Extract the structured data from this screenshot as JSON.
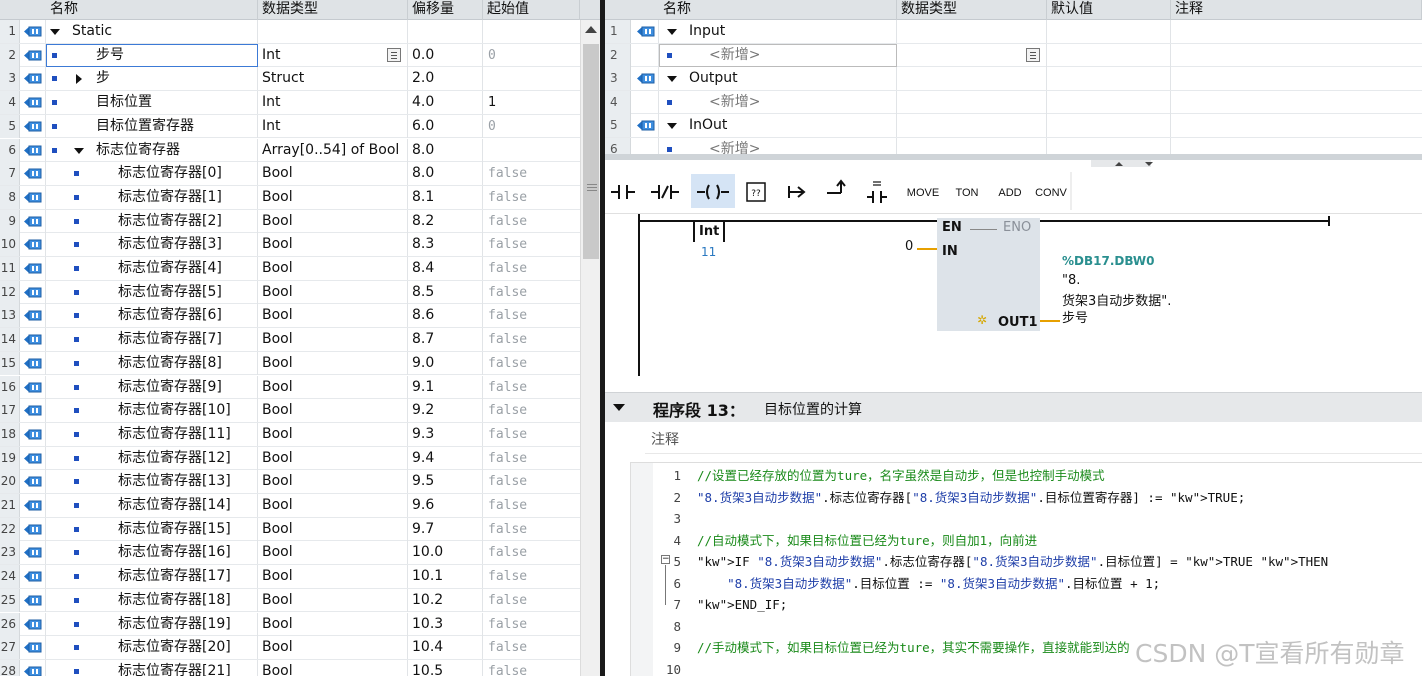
{
  "left_table": {
    "headers": {
      "name": "名称",
      "datatype": "数据类型",
      "offset": "偏移量",
      "start": "起始值"
    },
    "rows": [
      {
        "n": "1",
        "name": "Static",
        "type": "",
        "offset": "",
        "start": "",
        "level": 0,
        "marker": "down",
        "bullet": false
      },
      {
        "n": "2",
        "name": "步号",
        "type": "Int",
        "offset": "0.0",
        "start": "0",
        "level": 1,
        "marker": "",
        "bullet": true,
        "editing": true
      },
      {
        "n": "3",
        "name": "步",
        "type": "Struct",
        "offset": "2.0",
        "start": "",
        "level": 1,
        "marker": "right",
        "bullet": true
      },
      {
        "n": "4",
        "name": "目标位置",
        "type": "Int",
        "offset": "4.0",
        "start": "1",
        "level": 1,
        "marker": "",
        "bullet": true,
        "startdark": true
      },
      {
        "n": "5",
        "name": "目标位置寄存器",
        "type": "Int",
        "offset": "6.0",
        "start": "0",
        "level": 1,
        "marker": "",
        "bullet": true
      },
      {
        "n": "6",
        "name": "标志位寄存器",
        "type": "Array[0..54] of Bool",
        "offset": "8.0",
        "start": "",
        "level": 1,
        "marker": "down",
        "bullet": true
      },
      {
        "n": "7",
        "name": "标志位寄存器[0]",
        "type": "Bool",
        "offset": "8.0",
        "start": "false",
        "level": 2,
        "bullet": true
      },
      {
        "n": "8",
        "name": "标志位寄存器[1]",
        "type": "Bool",
        "offset": "8.1",
        "start": "false",
        "level": 2,
        "bullet": true
      },
      {
        "n": "9",
        "name": "标志位寄存器[2]",
        "type": "Bool",
        "offset": "8.2",
        "start": "false",
        "level": 2,
        "bullet": true
      },
      {
        "n": "10",
        "name": "标志位寄存器[3]",
        "type": "Bool",
        "offset": "8.3",
        "start": "false",
        "level": 2,
        "bullet": true
      },
      {
        "n": "11",
        "name": "标志位寄存器[4]",
        "type": "Bool",
        "offset": "8.4",
        "start": "false",
        "level": 2,
        "bullet": true
      },
      {
        "n": "12",
        "name": "标志位寄存器[5]",
        "type": "Bool",
        "offset": "8.5",
        "start": "false",
        "level": 2,
        "bullet": true
      },
      {
        "n": "13",
        "name": "标志位寄存器[6]",
        "type": "Bool",
        "offset": "8.6",
        "start": "false",
        "level": 2,
        "bullet": true
      },
      {
        "n": "14",
        "name": "标志位寄存器[7]",
        "type": "Bool",
        "offset": "8.7",
        "start": "false",
        "level": 2,
        "bullet": true
      },
      {
        "n": "15",
        "name": "标志位寄存器[8]",
        "type": "Bool",
        "offset": "9.0",
        "start": "false",
        "level": 2,
        "bullet": true
      },
      {
        "n": "16",
        "name": "标志位寄存器[9]",
        "type": "Bool",
        "offset": "9.1",
        "start": "false",
        "level": 2,
        "bullet": true
      },
      {
        "n": "17",
        "name": "标志位寄存器[10]",
        "type": "Bool",
        "offset": "9.2",
        "start": "false",
        "level": 2,
        "bullet": true
      },
      {
        "n": "18",
        "name": "标志位寄存器[11]",
        "type": "Bool",
        "offset": "9.3",
        "start": "false",
        "level": 2,
        "bullet": true
      },
      {
        "n": "19",
        "name": "标志位寄存器[12]",
        "type": "Bool",
        "offset": "9.4",
        "start": "false",
        "level": 2,
        "bullet": true
      },
      {
        "n": "20",
        "name": "标志位寄存器[13]",
        "type": "Bool",
        "offset": "9.5",
        "start": "false",
        "level": 2,
        "bullet": true
      },
      {
        "n": "21",
        "name": "标志位寄存器[14]",
        "type": "Bool",
        "offset": "9.6",
        "start": "false",
        "level": 2,
        "bullet": true
      },
      {
        "n": "22",
        "name": "标志位寄存器[15]",
        "type": "Bool",
        "offset": "9.7",
        "start": "false",
        "level": 2,
        "bullet": true
      },
      {
        "n": "23",
        "name": "标志位寄存器[16]",
        "type": "Bool",
        "offset": "10.0",
        "start": "false",
        "level": 2,
        "bullet": true
      },
      {
        "n": "24",
        "name": "标志位寄存器[17]",
        "type": "Bool",
        "offset": "10.1",
        "start": "false",
        "level": 2,
        "bullet": true
      },
      {
        "n": "25",
        "name": "标志位寄存器[18]",
        "type": "Bool",
        "offset": "10.2",
        "start": "false",
        "level": 2,
        "bullet": true
      },
      {
        "n": "26",
        "name": "标志位寄存器[19]",
        "type": "Bool",
        "offset": "10.3",
        "start": "false",
        "level": 2,
        "bullet": true
      },
      {
        "n": "27",
        "name": "标志位寄存器[20]",
        "type": "Bool",
        "offset": "10.4",
        "start": "false",
        "level": 2,
        "bullet": true
      },
      {
        "n": "28",
        "name": "标志位寄存器[21]",
        "type": "Bool",
        "offset": "10.5",
        "start": "false",
        "level": 2,
        "bullet": true
      }
    ]
  },
  "interface": {
    "headers": {
      "name": "名称",
      "datatype": "数据类型",
      "default": "默认值",
      "comment": "注释"
    },
    "rows": [
      {
        "n": "1",
        "name": "Input",
        "section": true
      },
      {
        "n": "2",
        "name": "<新增>",
        "section": false,
        "editing": true
      },
      {
        "n": "3",
        "name": "Output",
        "section": true
      },
      {
        "n": "4",
        "name": "<新增>",
        "section": false
      },
      {
        "n": "5",
        "name": "InOut",
        "section": true
      },
      {
        "n": "6",
        "name": "<新增>",
        "section": false
      }
    ]
  },
  "toolbar": {
    "items": [
      {
        "name": "no-contact-icon",
        "label": "⊣⊢"
      },
      {
        "name": "nc-contact-icon",
        "label": "⊣/⊢"
      },
      {
        "name": "coil-icon",
        "label": "—( )—"
      },
      {
        "name": "empty-box-icon",
        "label": "??"
      },
      {
        "name": "open-branch-icon",
        "label": "↦"
      },
      {
        "name": "close-branch-icon",
        "label": "↗"
      },
      {
        "name": "compare-icon",
        "label": "=="
      },
      {
        "name": "move-button",
        "label": "MOVE"
      },
      {
        "name": "ton-button",
        "label": "TON"
      },
      {
        "name": "add-button",
        "label": "ADD"
      },
      {
        "name": "conv-button",
        "label": "CONV"
      }
    ]
  },
  "ladder": {
    "compare_type": "Int",
    "compare_value": "11",
    "en": "EN",
    "eno": "ENO",
    "in_pin": "IN",
    "in_value": "0",
    "out_pin": "OUT1",
    "out_address": "%DB17.DBW0",
    "out_tag_line1": "\"8.",
    "out_tag_line2": "货架3自动步数据\".",
    "out_tag_line3": "步号"
  },
  "network": {
    "label": "程序段 13：",
    "title": "目标位置的计算",
    "comment_placeholder": "注释"
  },
  "scl": {
    "lines": [
      {
        "n": "1",
        "text": "//设置已经存放的位置为ture，名字虽然是自动步，但是也控制手动模式",
        "kind": "comment"
      },
      {
        "n": "2",
        "text": "\"8.货架3自动步数据\".标志位寄存器[\"8.货架3自动步数据\".目标位置寄存器] := TRUE;",
        "kind": "code"
      },
      {
        "n": "3",
        "text": "",
        "kind": "code"
      },
      {
        "n": "4",
        "text": "//自动模式下，如果目标位置已经为ture，则自加1，向前进",
        "kind": "comment"
      },
      {
        "n": "5",
        "text": "IF \"8.货架3自动步数据\".标志位寄存器[\"8.货架3自动步数据\".目标位置] = TRUE THEN",
        "kind": "code"
      },
      {
        "n": "6",
        "text": "    \"8.货架3自动步数据\".目标位置 := \"8.货架3自动步数据\".目标位置 + 1;",
        "kind": "code"
      },
      {
        "n": "7",
        "text": "END_IF;",
        "kind": "code"
      },
      {
        "n": "8",
        "text": "",
        "kind": "code"
      },
      {
        "n": "9",
        "text": "//手动模式下，如果目标位置已经为ture，其实不需要操作，直接就能到达的",
        "kind": "comment"
      },
      {
        "n": "10",
        "text": "",
        "kind": "code"
      }
    ]
  },
  "watermark": "CSDN @T宣看所有勋章"
}
